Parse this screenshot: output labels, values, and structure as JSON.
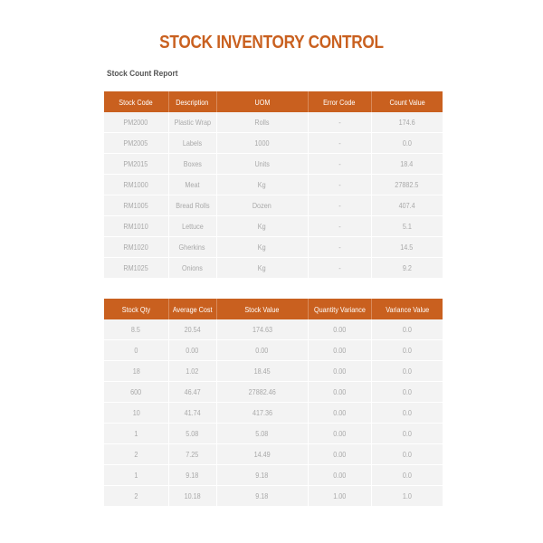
{
  "document": {
    "title": "STOCK INVENTORY CONTROL",
    "subtitle": "Stock Count Report",
    "accent_color": "#c9601f"
  },
  "table1": {
    "headers": [
      "Stock Code",
      "Description",
      "UOM",
      "Error Code",
      "Count Value"
    ],
    "rows": [
      [
        "PM2000",
        "Plastic Wrap",
        "Rolls",
        "-",
        "174.6"
      ],
      [
        "PM2005",
        "Labels",
        "1000",
        "-",
        "0.0"
      ],
      [
        "PM2015",
        "Boxes",
        "Units",
        "-",
        "18.4"
      ],
      [
        "RM1000",
        "Meat",
        "Kg",
        "-",
        "27882.5"
      ],
      [
        "RM1005",
        "Bread Rolls",
        "Dozen",
        "-",
        "407.4"
      ],
      [
        "RM1010",
        "Lettuce",
        "Kg",
        "-",
        "5.1"
      ],
      [
        "RM1020",
        "Gherkins",
        "Kg",
        "-",
        "14.5"
      ],
      [
        "RM1025",
        "Onions",
        "Kg",
        "-",
        "9.2"
      ]
    ]
  },
  "table2": {
    "headers": [
      "Stock Qty",
      "Average Cost",
      "Stock Value",
      "Quantity Variance",
      "Variance Value"
    ],
    "rows": [
      [
        "8.5",
        "20.54",
        "174.63",
        "0.00",
        "0.0"
      ],
      [
        "0",
        "0.00",
        "0.00",
        "0.00",
        "0.0"
      ],
      [
        "18",
        "1.02",
        "18.45",
        "0.00",
        "0.0"
      ],
      [
        "600",
        "46.47",
        "27882.46",
        "0.00",
        "0.0"
      ],
      [
        "10",
        "41.74",
        "417.36",
        "0.00",
        "0.0"
      ],
      [
        "1",
        "5.08",
        "5.08",
        "0.00",
        "0.0"
      ],
      [
        "2",
        "7.25",
        "14.49",
        "0.00",
        "0.0"
      ],
      [
        "1",
        "9.18",
        "9.18",
        "0.00",
        "0.0"
      ],
      [
        "2",
        "10.18",
        "9.18",
        "1.00",
        "1.0"
      ]
    ]
  }
}
